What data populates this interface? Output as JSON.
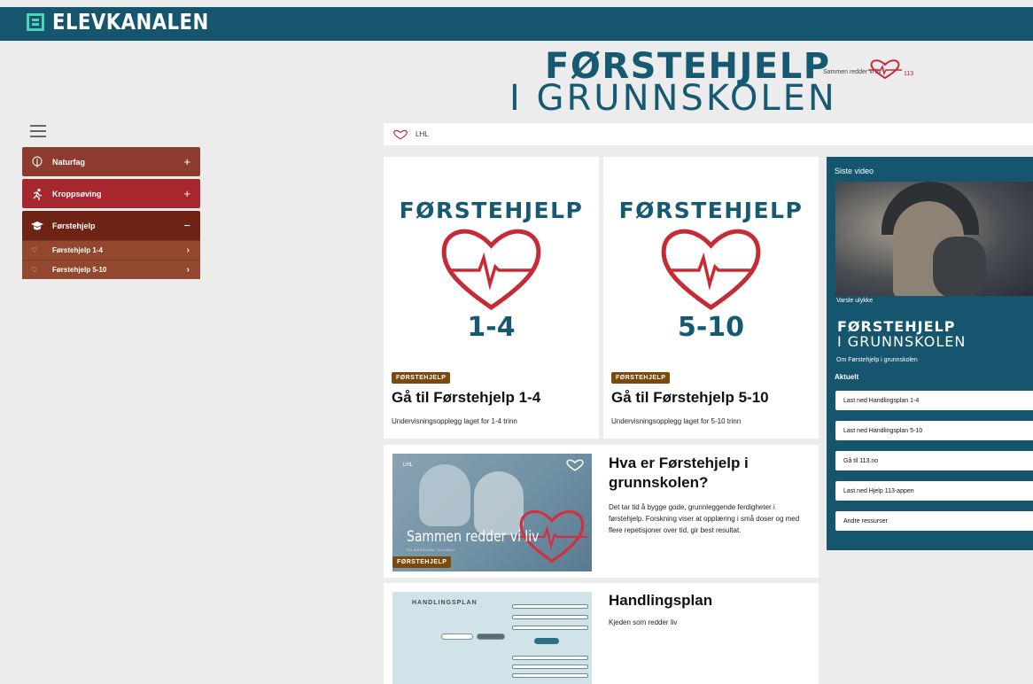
{
  "header": {
    "logo_text": "ELEVKANALEN",
    "accent": "#15566e"
  },
  "hero": {
    "line1": "FØRSTEHJELP",
    "line2": "I GRUNNSKOLEN",
    "tagline": "Sammen redder vi liv",
    "emergency_number": "113"
  },
  "sidebar": {
    "menu_icon": "hamburger-icon",
    "items": [
      {
        "label": "Naturfag",
        "icon": "leaf-icon",
        "toggle": "+"
      },
      {
        "label": "Kroppsøving",
        "icon": "runner-icon",
        "toggle": "+"
      },
      {
        "label": "Førstehjelp",
        "icon": "graduation-cap-icon",
        "toggle": "−"
      }
    ],
    "subitems": [
      {
        "label": "Førstehjelp 1-4",
        "arrow": "›"
      },
      {
        "label": "Førstehjelp 5-10",
        "arrow": "›"
      }
    ]
  },
  "breadcrumb": {
    "label": "LHL",
    "icon": "heart-icon"
  },
  "cards": [
    {
      "logo_title": "FØRSTEHJELP",
      "grade": "1-4",
      "badge": "FØRSTEHJELP",
      "title": "Gå til Førstehjelp 1-4",
      "desc": "Undervisningsopplegg laget for 1-4 trinn"
    },
    {
      "logo_title": "FØRSTEHJELP",
      "grade": "5-10",
      "badge": "FØRSTEHJELP",
      "title": "Gå til Førstehjelp 5-10",
      "desc": "Undervisningsopplegg laget for 5-10 trinn"
    }
  ],
  "article": {
    "image_brand": "LHL",
    "image_text": "Sammen redder vi liv",
    "image_subtext": "EN NASJONAL DUGNAD",
    "badge": "FØRSTEHJELP",
    "title": "Hva er Førstehjelp i grunnskolen?",
    "body": "Det tar tid å bygge gode, grunnleggende ferdigheter i førstehjelp. Forskning viser at opplæring i små doser og med flere repetisjoner over tid, gir best resultat."
  },
  "plan": {
    "image_title": "HANDLINGSPLAN",
    "title": "Handlingsplan",
    "desc": "Kjeden som redder liv"
  },
  "panel": {
    "title": "Siste video",
    "video_caption": "Varsle ulykke",
    "logo_line1": "FØRSTEHJELP",
    "logo_line2": "I GRUNNSKOLEN",
    "about": "Om Førstehjelp i grunnskolen",
    "section": "Aktuelt",
    "links": [
      "Last ned Handlingsplan 1-4",
      "Last ned Handlingsplan 5-10",
      "Gå til 113.no",
      "Last ned Hjelp 113-appen",
      "Andre ressurser"
    ]
  },
  "colors": {
    "heart": "#c62a35",
    "brand_teal": "#155a72",
    "badge": "#7a4a0c"
  }
}
